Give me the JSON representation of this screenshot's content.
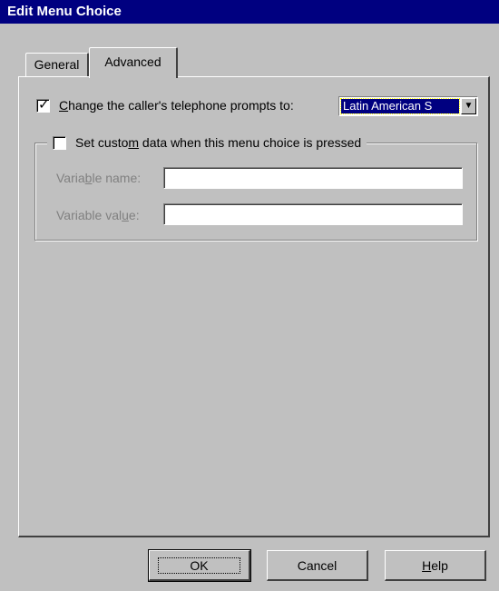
{
  "window": {
    "title": "Edit Menu Choice"
  },
  "tabs": [
    {
      "label": "General"
    },
    {
      "label": "Advanced"
    }
  ],
  "advanced": {
    "change_prompts": {
      "checked": true,
      "label_pre": "",
      "label_ul": "C",
      "label_post": "hange the caller's telephone prompts to:",
      "selected_value": "Latin American S"
    },
    "custom_data": {
      "checked": false,
      "label_pre": "Set custo",
      "label_ul": "m",
      "label_post": " data when this menu choice is pressed",
      "variable_name_label_pre": "Varia",
      "variable_name_label_ul": "b",
      "variable_name_label_post": "le name:",
      "variable_name_value": "",
      "variable_value_label_pre": "Variable val",
      "variable_value_label_ul": "u",
      "variable_value_label_post": "e:",
      "variable_value_value": ""
    }
  },
  "buttons": {
    "ok": "OK",
    "cancel": "Cancel",
    "help_ul": "H",
    "help_post": "elp"
  },
  "icons": {
    "checkmark": "checkmark-icon",
    "dropdown": "dropdown-arrow-icon"
  }
}
